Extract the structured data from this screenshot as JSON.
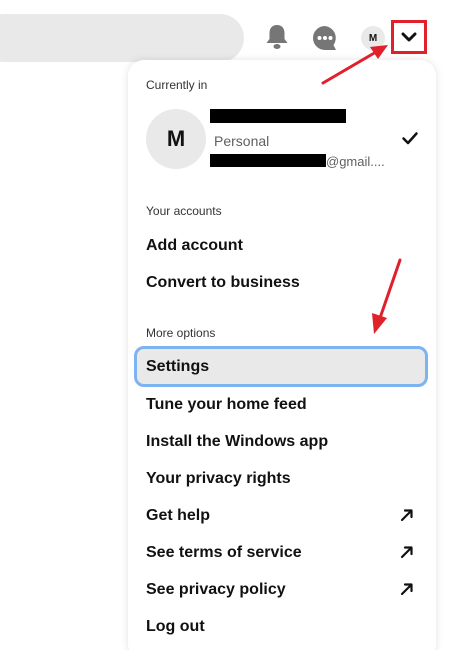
{
  "header": {
    "avatar_initial": "M"
  },
  "menu": {
    "currently_in_label": "Currently in",
    "account": {
      "avatar_initial": "M",
      "type": "Personal",
      "email_suffix": "@gmail...."
    },
    "your_accounts_label": "Your accounts",
    "your_accounts_items": [
      "Add account",
      "Convert to business"
    ],
    "more_options_label": "More options",
    "more_options_items": [
      "Settings",
      "Tune your home feed",
      "Install the Windows app",
      "Your privacy rights",
      "Get help",
      "See terms of service",
      "See privacy policy",
      "Log out"
    ],
    "selected_item": "Settings"
  },
  "colors": {
    "highlight_box": "#e0202a",
    "annotation_arrow": "#e0202a",
    "selected_outline": "#7db3f0",
    "selected_fill": "#e9e9e9"
  },
  "icons": {
    "notifications": "bell-icon",
    "messages": "chat-icon",
    "dropdown": "chevron-down-icon",
    "current_account": "check-icon",
    "external_link": "external-arrow-icon"
  }
}
